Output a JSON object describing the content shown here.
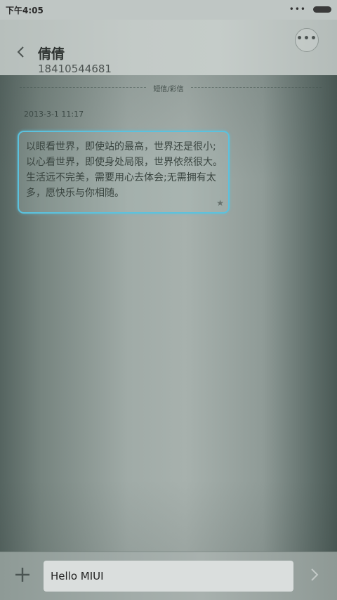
{
  "status_bar": {
    "time": "下午4:05",
    "signal_dots": "•••"
  },
  "header": {
    "contact_name": "倩倩",
    "contact_number": "18410544681",
    "more_label": "•••"
  },
  "conversation": {
    "divider_label": "短信/彩信",
    "timestamp": "2013-3-1 11:17",
    "message_text": "以眼看世界，即使站的最高，世界还是很小;以心看世界，即使身处局限，世界依然很大。生活远不完美，需要用心去体会;无需拥有太多，愿快乐与你相随。",
    "star": "★"
  },
  "composer": {
    "input_value": "Hello MIUI"
  },
  "colors": {
    "bubble_border": "#5bc2de"
  }
}
